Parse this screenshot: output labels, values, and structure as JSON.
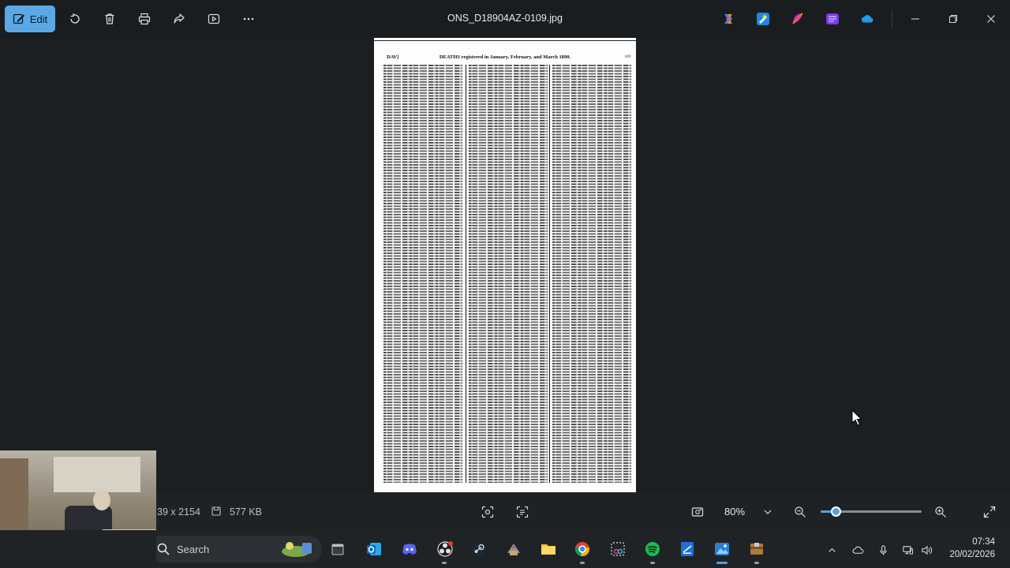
{
  "app": {
    "edit_label": "Edit",
    "filename": "ONS_D18904AZ-0109.jpg",
    "toolbar_icons": [
      "rotate-icon",
      "delete-icon",
      "print-icon",
      "share-icon",
      "slideshow-icon",
      "more-icon"
    ],
    "app_icons": [
      "copilot-icon",
      "designer-icon",
      "cocreator-icon",
      "clipchamp-icon",
      "onedrive-icon"
    ]
  },
  "document": {
    "left_heading": "DAV]",
    "title": "DEATHS registered in January, February, and March 1890.",
    "page_number": "109"
  },
  "bottom_bar": {
    "dimensions": "39 x 2154",
    "file_size": "577 KB",
    "zoom": "80%",
    "zoom_level": 0.15
  },
  "taskbar": {
    "search_placeholder": "Search",
    "apps": [
      "file-explorer-black-icon",
      "outlook-icon",
      "discord-icon",
      "obs-icon",
      "steam-icon",
      "game-icon",
      "folder-icon",
      "chrome-icon",
      "snipping-tool-icon",
      "spotify-icon",
      "dropbox-paper-icon",
      "photos-icon",
      "archive-icon"
    ],
    "time": "07:34",
    "date": "20/02/2026"
  }
}
